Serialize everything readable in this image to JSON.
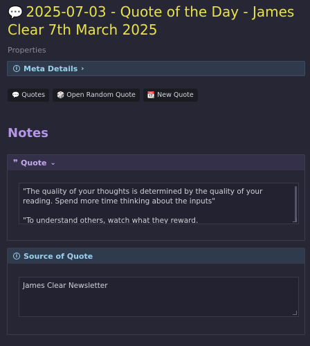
{
  "page": {
    "title_icon": "speech-bubble",
    "title": "2025-07-03 - Quote of the Day - James Clear 7th March 2025",
    "properties_label": "Properties"
  },
  "meta": {
    "label": "Meta Details",
    "icon": "info-circle",
    "chevron": "›"
  },
  "buttons": [
    {
      "icon": "speech-bubble",
      "label": "Quotes"
    },
    {
      "icon": "dice",
      "label": "Open Random Quote"
    },
    {
      "icon": "calendar",
      "label": "New Quote"
    }
  ],
  "notes_heading": "Notes",
  "quote_callout": {
    "label": "Quote",
    "icon": "quote-mark",
    "chevron": "⌄",
    "lines": [
      "\"The quality of your thoughts is determined by the quality of your reading. Spend more time thinking about the inputs\"",
      "\"To understand others, watch what they reward."
    ]
  },
  "source_callout": {
    "label": "Source of Quote",
    "icon": "info-circle",
    "value": "James Clear Newsletter"
  },
  "colors": {
    "background": "#262635",
    "title": "#e8e24a",
    "notes": "#b595e8",
    "info_accent": "#9ad2ee",
    "quote_accent": "#c4a8ee"
  }
}
